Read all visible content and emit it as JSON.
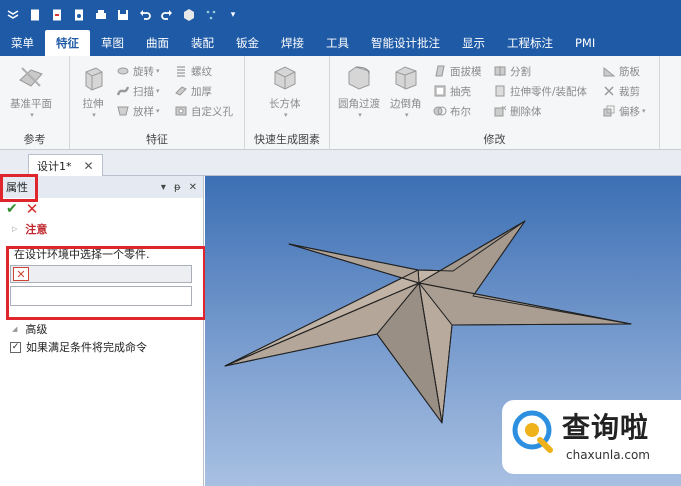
{
  "quick_access": [
    "app-menu-icon",
    "new-icon",
    "open-icon",
    "save-as-icon",
    "print-icon",
    "save-icon",
    "undo-icon",
    "redo-icon",
    "rebuild-icon",
    "pmi-icon",
    "dropdown-icon"
  ],
  "tabs": [
    {
      "label": "菜单"
    },
    {
      "label": "特征"
    },
    {
      "label": "草图"
    },
    {
      "label": "曲面"
    },
    {
      "label": "装配"
    },
    {
      "label": "钣金"
    },
    {
      "label": "焊接"
    },
    {
      "label": "工具"
    },
    {
      "label": "智能设计批注"
    },
    {
      "label": "显示"
    },
    {
      "label": "工程标注"
    },
    {
      "label": "PMI"
    }
  ],
  "ribbon": {
    "ref_group": {
      "label": "参考",
      "base_plane": "基准平面"
    },
    "feature_group": {
      "label": "特征",
      "extrude": "拉伸",
      "revolve": "旋转",
      "sweep": "扫描",
      "loft": "放样",
      "thread": "螺纹",
      "thicken": "加厚",
      "custom_hole": "自定义孔"
    },
    "quick_group": {
      "label": "快速生成图素",
      "box": "长方体"
    },
    "modify_group": {
      "label": "修改",
      "fillet": "圆角过渡",
      "chamfer": "边倒角",
      "draft": "面拔模",
      "shell": "抽壳",
      "boolean": "布尔",
      "split": "分割",
      "extrude_to_assembly": "拉伸零件/装配体",
      "delete_body": "删除体",
      "rib": "筋板",
      "trim": "裁剪",
      "offset": "偏移"
    }
  },
  "document": {
    "tab_label": "设计1*",
    "close": "✕"
  },
  "panel": {
    "title": "属性",
    "note_label": "注意",
    "instruction": "在设计环境中选择一个零件.",
    "advanced_label": "高级",
    "checkbox_label": "如果满足条件将完成命令",
    "checkbox_checked": true
  },
  "watermark": {
    "brand": "查询啦",
    "url": "chaxunla.com"
  },
  "colors": {
    "accent": "#1f5aa6",
    "highlight": "#e0262d",
    "star_fill": "#b5a89b"
  }
}
